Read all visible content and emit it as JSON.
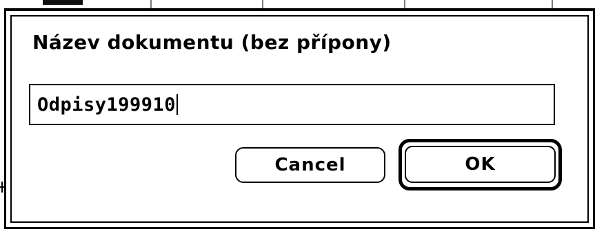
{
  "dialog": {
    "prompt": "Název dokumentu (bez přípony)",
    "filename_input": {
      "value": "Odpisy199910"
    },
    "buttons": {
      "cancel_label": "Cancel",
      "ok_label": "OK",
      "default_button": "OK"
    }
  }
}
